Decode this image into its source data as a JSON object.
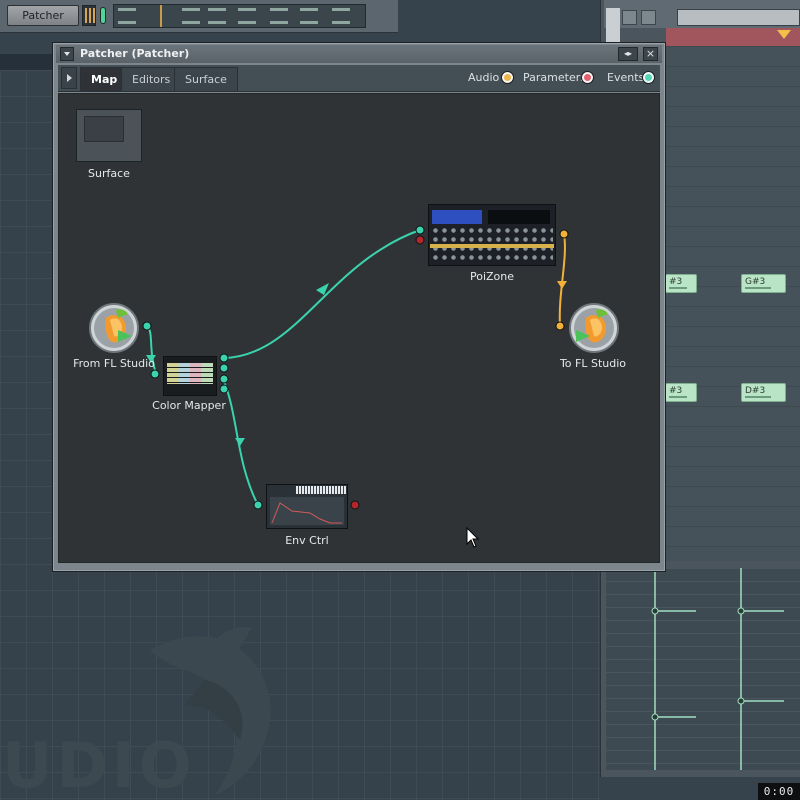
{
  "channel": {
    "name_button": "Patcher"
  },
  "patcher": {
    "title": "Patcher (Patcher)",
    "nav_arrows": "◂▸",
    "close": "×",
    "tabs": [
      {
        "label": "Map",
        "active": true
      },
      {
        "label": "Editors",
        "active": false
      },
      {
        "label": "Surface",
        "active": false
      }
    ],
    "legend": [
      {
        "label": "Audio",
        "color": "#f0b54a"
      },
      {
        "label": "Parameters",
        "color": "#e4606a"
      },
      {
        "label": "Events",
        "color": "#4fd9b4"
      }
    ],
    "nodes": {
      "surface": "Surface",
      "from_fl": "From FL Studio",
      "color_mapper": "Color Mapper",
      "poizone": "PoiZone",
      "to_fl": "To FL Studio",
      "env_ctrl": "Env Ctrl"
    },
    "wire_colors": {
      "events": "#3ad3ae",
      "audio": "#f2b23a",
      "parameters": "#b3262c"
    }
  },
  "piano_roll": {
    "notes": [
      {
        "label": "#3"
      },
      {
        "label": "G#3"
      },
      {
        "label": "#3"
      },
      {
        "label": "D#3"
      }
    ]
  },
  "watermark": "UDIO",
  "time_display": "0:00"
}
